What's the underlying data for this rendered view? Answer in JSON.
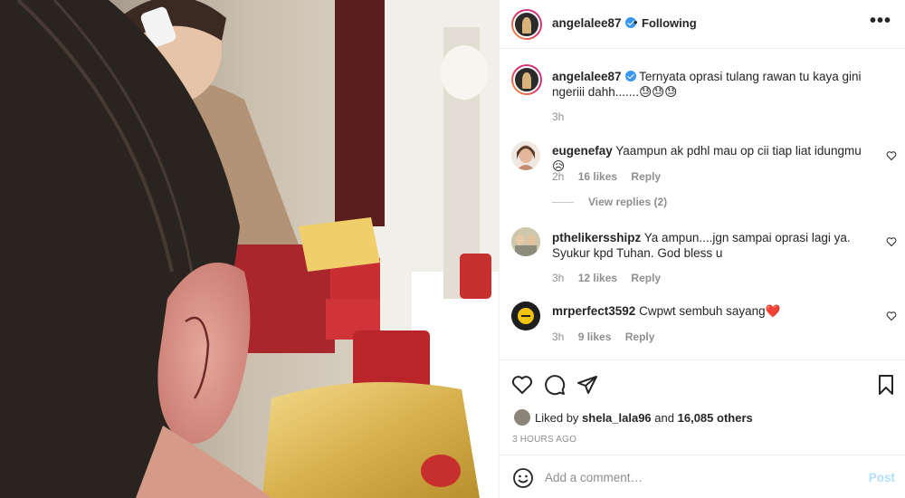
{
  "post": {
    "username": "angelalee87",
    "follow_status": "Following",
    "separator": "•",
    "more_label": "•••",
    "caption": {
      "username": "angelalee87",
      "text": "Ternyata oprasi tulang rawan tu kaya gini ngeriii dahh.......",
      "emojis": "😓😓😓",
      "age": "3h"
    },
    "comments": [
      {
        "username": "eugenefay",
        "text": "Yaampun ak pdhl mau op cii tiap liat idungmu",
        "emoji": "😥",
        "age": "2h",
        "likes": "16 likes",
        "reply": "Reply"
      },
      {
        "username": "pthelikersshipz",
        "text": "Ya ampun....jgn sampai oprasi lagi ya. Syukur kpd Tuhan. God bless u",
        "emoji": "",
        "age": "3h",
        "likes": "12 likes",
        "reply": "Reply"
      },
      {
        "username": "mrperfect3592",
        "text": "Cwpwt sembuh sayang",
        "emoji": "❤️",
        "age": "3h",
        "likes": "9 likes",
        "reply": "Reply"
      }
    ],
    "view_replies": "View replies (2)",
    "liked_by_prefix": "Liked by",
    "liked_by_user": "shela_lala96",
    "liked_by_and": "and",
    "liked_by_others": "16,085 others",
    "timestamp": "3 HOURS AGO",
    "add_comment_placeholder": "Add a comment…",
    "post_button": "Post"
  },
  "colors": {
    "verified": "#3897f0",
    "post_disabled": "#b2dffc",
    "muted": "#8e8e8e"
  }
}
